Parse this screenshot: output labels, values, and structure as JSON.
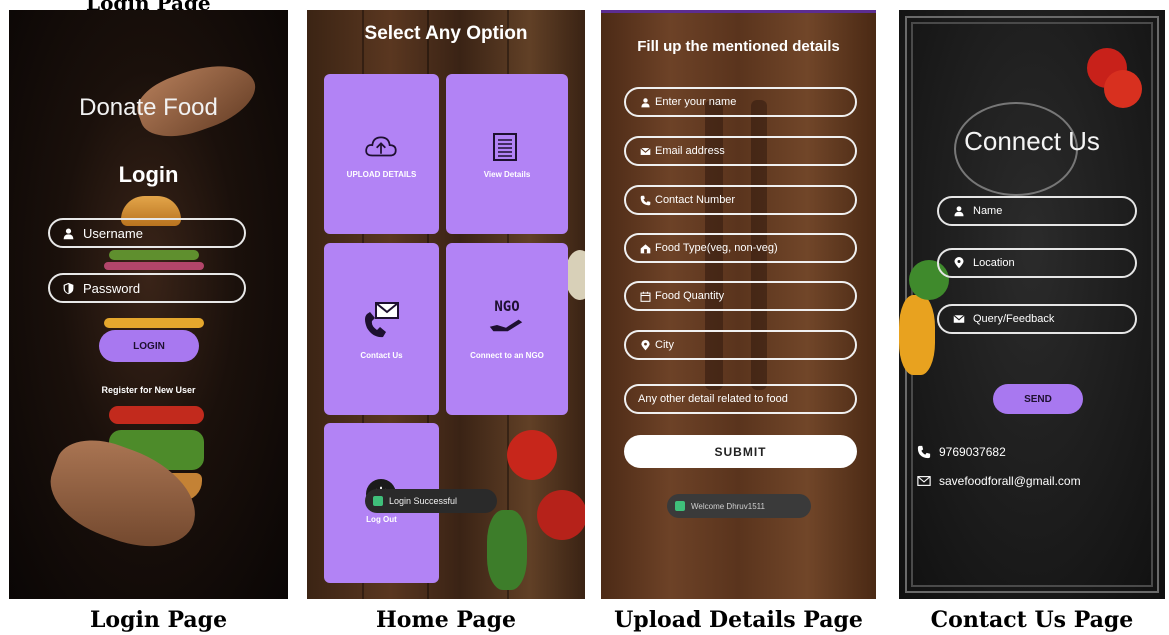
{
  "top_text": "Login Page",
  "login": {
    "app_title": "Donate Food",
    "heading": "Login",
    "username_placeholder": "Username",
    "password_placeholder": "Password",
    "login_button": "LOGIN",
    "register_link": "Register for New User",
    "caption": "Login Page"
  },
  "home": {
    "title": "Select Any Option",
    "tiles": [
      {
        "label": "UPLOAD DETAILS",
        "icon": "cloud-upload-icon"
      },
      {
        "label": "View Details",
        "icon": "list-icon"
      },
      {
        "label": "Contact Us",
        "icon": "phone-mail-icon"
      },
      {
        "label": "Connect to an NGO",
        "icon": "ngo-hand-icon",
        "icon_text": "NGO"
      },
      {
        "label": "Log Out",
        "icon": "power-icon"
      }
    ],
    "toast": "Login Successful",
    "caption": "Home Page"
  },
  "upload": {
    "title": "Fill up the mentioned details",
    "fields": [
      {
        "placeholder": "Enter your name",
        "icon": "person-icon"
      },
      {
        "placeholder": "Email address",
        "icon": "mail-icon"
      },
      {
        "placeholder": "Contact Number",
        "icon": "phone-icon"
      },
      {
        "placeholder": "Food Type(veg, non-veg)",
        "icon": "home-icon"
      },
      {
        "placeholder": "Food Quantity",
        "icon": "calendar-icon"
      },
      {
        "placeholder": "City",
        "icon": "location-icon"
      },
      {
        "placeholder": "Any other detail related to food",
        "icon": ""
      }
    ],
    "submit_button": "SUBMIT",
    "toast": "Welcome Dhruv1511",
    "caption": "Upload Details Page"
  },
  "contact": {
    "title": "Connect Us",
    "fields": [
      {
        "placeholder": "Name",
        "icon": "person-icon"
      },
      {
        "placeholder": "Location",
        "icon": "location-icon"
      },
      {
        "placeholder": "Query/Feedback",
        "icon": "mail-icon"
      }
    ],
    "send_button": "SEND",
    "phone": "9769037682",
    "email": "savefoodforall@gmail.com",
    "caption": "Contact Us Page"
  },
  "colors": {
    "accent_purple": "#b283f5",
    "button_purple": "#a878f0",
    "toast_green": "#3fbf7a"
  }
}
